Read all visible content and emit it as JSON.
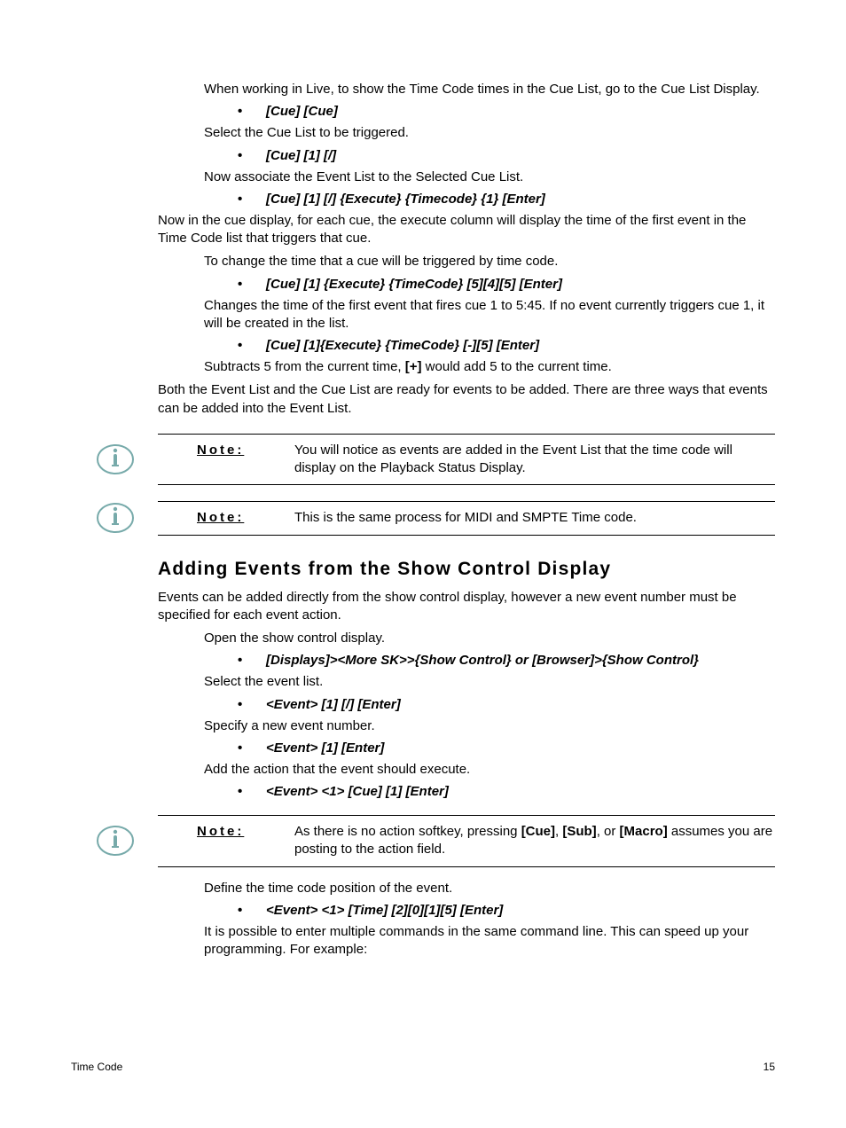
{
  "intro": {
    "p1": "When working in Live, to show the Time Code times in the Cue List, go to the Cue List Display.",
    "cmd1": "[Cue] [Cue]",
    "p2": "Select the Cue List to be triggered.",
    "cmd2": "[Cue] [1] [/]",
    "p3": "Now associate the Event List to the Selected Cue List.",
    "cmd3": "[Cue] [1] [/] {Execute} {Timecode} {1} [Enter]",
    "p4": "Now in the cue display, for each cue, the execute column will display the time of the first event in the Time Code list that triggers that cue.",
    "p5": "To change the time that a cue will be triggered by time code.",
    "cmd4": "[Cue] [1] {Execute} {TimeCode} [5][4][5] [Enter]",
    "p6": "Changes the time of the first event that fires cue 1 to 5:45. If no event currently triggers cue 1, it will be created in the list.",
    "cmd5": "[Cue] [1]{Execute} {TimeCode} [-][5] [Enter]",
    "p7a": "Subtracts 5 from the current time, ",
    "p7b": "[+]",
    "p7c": " would add 5 to the current time.",
    "p8": "Both the Event List and the Cue List are ready for events to be added. There are three ways that events can be added into the Event List."
  },
  "note_label": "Note:",
  "note1": "You will notice as events are added in the Event List that the time code will display on the Playback Status Display.",
  "note2": "This is the same process for MIDI and SMPTE Time code.",
  "heading": "Adding Events from the Show Control Display",
  "body2": {
    "p1": "Events can be added directly from the show control display, however a new event number must be specified for each event action.",
    "p2": "Open the show control display.",
    "cmd1": "[Displays]><More SK>>{Show Control} or [Browser]>{Show Control}",
    "p3": "Select the event list.",
    "cmd2": "<Event> [1] [/] [Enter]",
    "p4": "Specify a new event number.",
    "cmd3": "<Event> [1] [Enter]",
    "p5": "Add the action that the event should execute.",
    "cmd4": "<Event> <1> [Cue] [1] [Enter]"
  },
  "note3a": "As there is no action softkey, pressing ",
  "note3b": "[Cue]",
  "note3c": ", ",
  "note3d": "[Sub]",
  "note3e": ", or ",
  "note3f": "[Macro]",
  "note3g": " assumes you are posting to the action field.",
  "body3": {
    "p1": "Define the time code position of the event.",
    "cmd1": "<Event> <1> [Time] [2][0][1][5] [Enter]",
    "p2": "It is possible to enter multiple commands in the same command line. This can speed up your programming. For example:"
  },
  "footer_left": "Time Code",
  "footer_right": "15"
}
